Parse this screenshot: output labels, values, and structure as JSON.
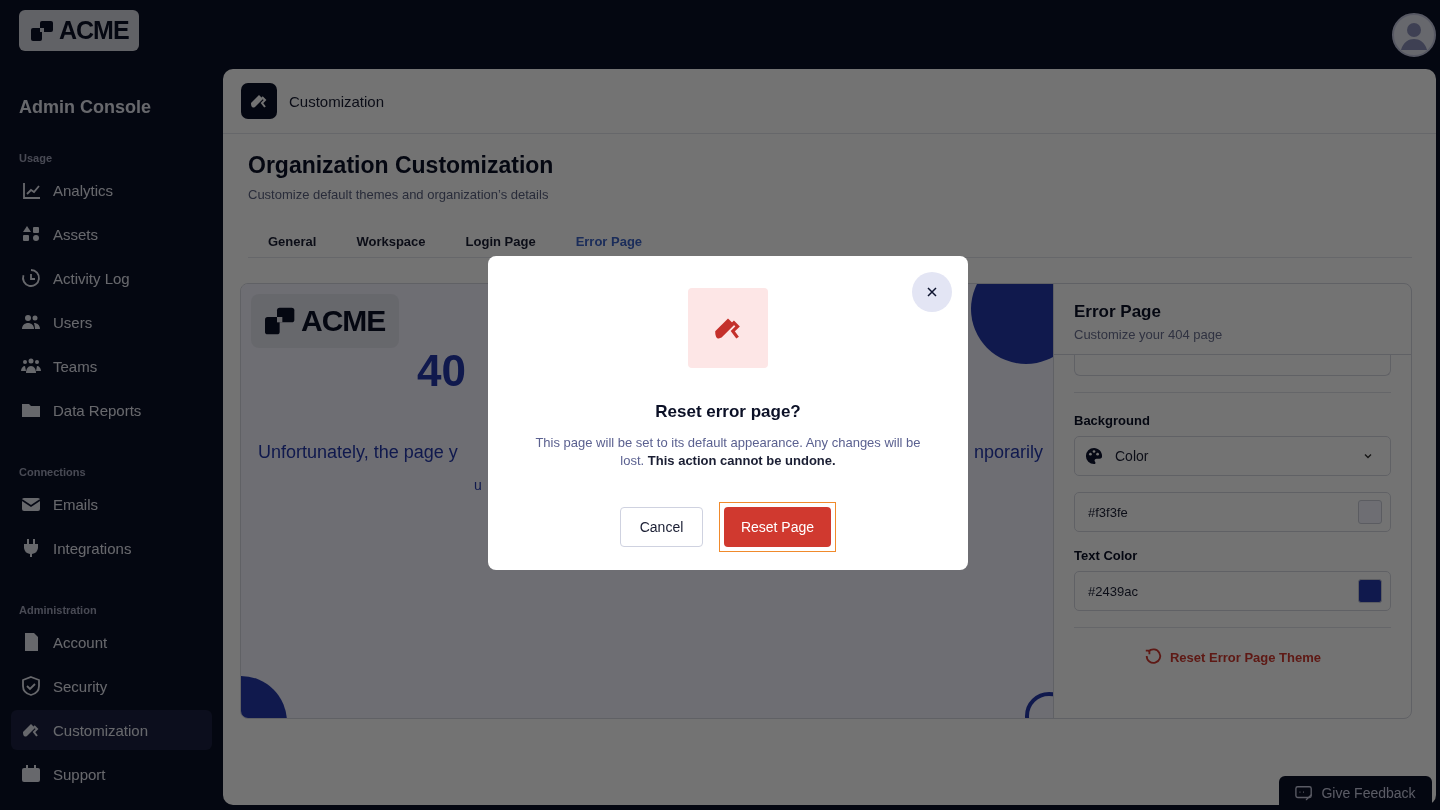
{
  "logo": {
    "text": "ACME"
  },
  "sidebar": {
    "title": "Admin Console",
    "sections": [
      {
        "heading": "Usage",
        "items": [
          {
            "label": "Analytics",
            "selected": false
          },
          {
            "label": "Assets",
            "selected": false
          },
          {
            "label": "Activity Log",
            "selected": false
          },
          {
            "label": "Users",
            "selected": false
          },
          {
            "label": "Teams",
            "selected": false
          },
          {
            "label": "Data Reports",
            "selected": false
          }
        ]
      },
      {
        "heading": "Connections",
        "items": [
          {
            "label": "Emails",
            "selected": false
          },
          {
            "label": "Integrations",
            "selected": false
          }
        ]
      },
      {
        "heading": "Administration",
        "items": [
          {
            "label": "Account",
            "selected": false
          },
          {
            "label": "Security",
            "selected": false
          },
          {
            "label": "Customization",
            "selected": true
          },
          {
            "label": "Support",
            "selected": false
          }
        ]
      }
    ]
  },
  "header": {
    "title": "Customization"
  },
  "page": {
    "title": "Organization Customization",
    "subtitle": "Customize default themes and organization’s details"
  },
  "tabs": [
    {
      "label": "General",
      "selected": false
    },
    {
      "label": "Workspace",
      "selected": false
    },
    {
      "label": "Login Page",
      "selected": false
    },
    {
      "label": "Error Page",
      "selected": true
    }
  ],
  "preview": {
    "logo": "ACME",
    "heading": "40",
    "message_left": "Unfortunately, the page y",
    "message_right": "nporarily",
    "message_line2": "u"
  },
  "settings": {
    "title": "Error Page",
    "subtitle": "Customize your 404 page",
    "background_label": "Background",
    "background_type": "Color",
    "background_value": "#f3f3fe",
    "text_color_label": "Text Color",
    "text_color_value": "#2439ac",
    "reset_link": "Reset Error Page Theme"
  },
  "dialog": {
    "title": "Reset error page?",
    "message": "This page will be set to its default appearance. Any changes will be lost. **This action cannot be undone.**",
    "cancel": "Cancel",
    "confirm": "Reset Page"
  },
  "feedback": {
    "label": "Give Feedback"
  }
}
